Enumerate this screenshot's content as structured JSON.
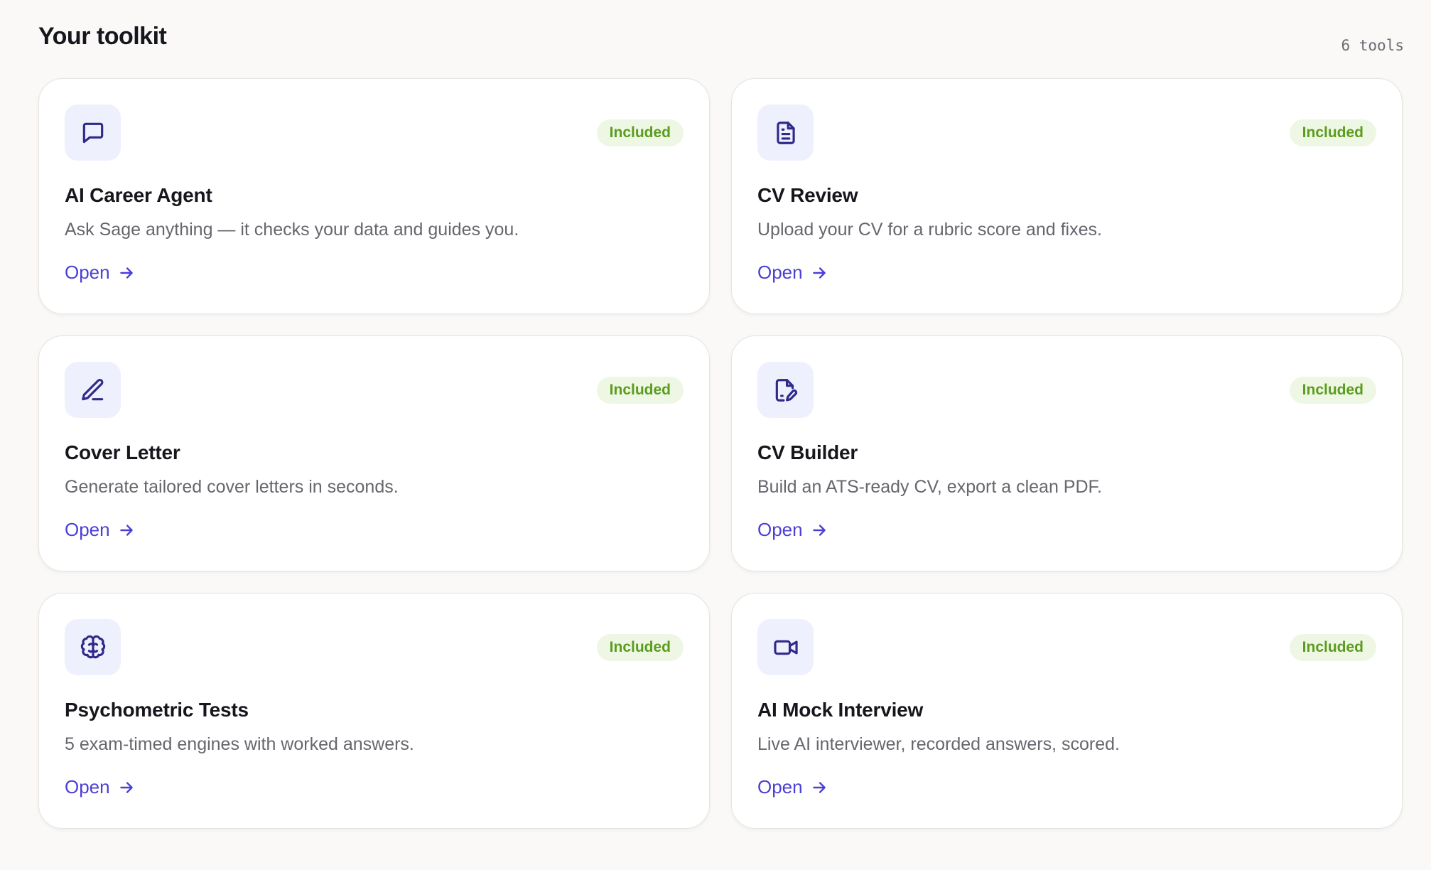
{
  "header": {
    "title": "Your toolkit",
    "count": "6 tools"
  },
  "cards": [
    {
      "title": "AI Career Agent",
      "description": "Ask Sage anything — it checks your data and guides you.",
      "badge": "Included",
      "link": "Open",
      "icon": "chat-bubble-icon"
    },
    {
      "title": "CV Review",
      "description": "Upload your CV for a rubric score and fixes.",
      "badge": "Included",
      "link": "Open",
      "icon": "document-icon"
    },
    {
      "title": "Cover Letter",
      "description": "Generate tailored cover letters in seconds.",
      "badge": "Included",
      "link": "Open",
      "icon": "pen-icon"
    },
    {
      "title": "CV Builder",
      "description": "Build an ATS-ready CV, export a clean PDF.",
      "badge": "Included",
      "link": "Open",
      "icon": "file-edit-icon"
    },
    {
      "title": "Psychometric Tests",
      "description": "5 exam-timed engines with worked answers.",
      "badge": "Included",
      "link": "Open",
      "icon": "brain-icon"
    },
    {
      "title": "AI Mock Interview",
      "description": "Live AI interviewer, recorded answers, scored.",
      "badge": "Included",
      "link": "Open",
      "icon": "video-camera-icon"
    }
  ],
  "colors": {
    "accent": "#4b3fd6",
    "icon_stroke": "#2f2a8a",
    "icon_tile_bg": "#eff0fd",
    "badge_bg": "#eef7e3",
    "badge_text": "#5b9c1f",
    "page_bg": "#faf9f7"
  }
}
